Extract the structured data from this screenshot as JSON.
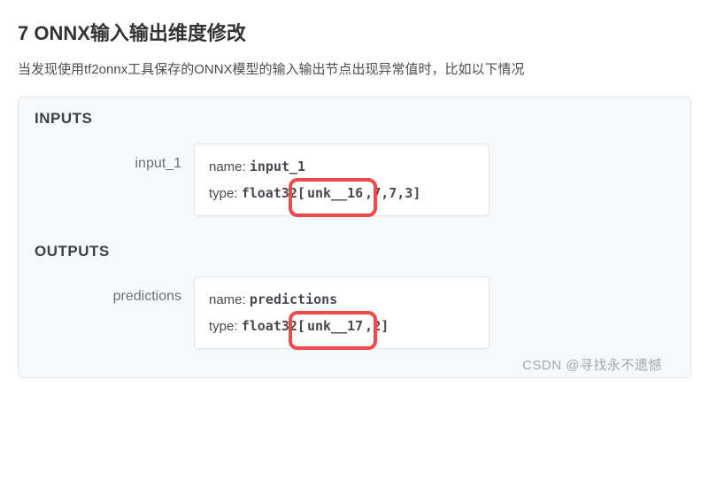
{
  "heading": "7 ONNX输入输出维度修改",
  "intro": "当发现使用tf2onnx工具保存的ONNX模型的输入输出节点出现异常值时，比如以下情况",
  "panel": {
    "inputs_title": "INPUTS",
    "outputs_title": "OUTPUTS",
    "inputs": {
      "label": "input_1",
      "name_key": "name:",
      "name_value": "input_1",
      "type_key": "type:",
      "type_prefix": "float32",
      "type_shape_pre": "[",
      "type_highlight": "unk__16",
      "type_shape_post": ",7,7,3]"
    },
    "outputs": {
      "label": "predictions",
      "name_key": "name:",
      "name_value": "predictions",
      "type_key": "type:",
      "type_prefix": "float32",
      "type_shape_pre": "[",
      "type_highlight": "unk__17",
      "type_shape_post": ",2]"
    }
  },
  "watermark": "CSDN @寻找永不遗憾"
}
